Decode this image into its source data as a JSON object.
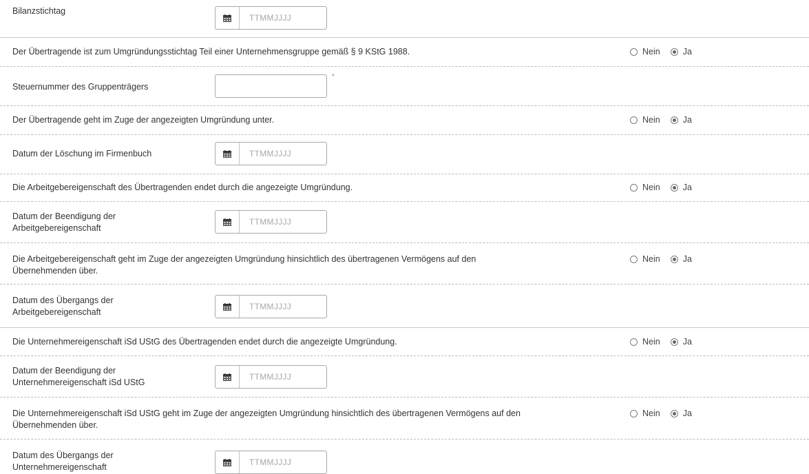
{
  "date_placeholder": "TTMMJJJJ",
  "radio_labels": {
    "no": "Nein",
    "yes": "Ja"
  },
  "required_mark": "*",
  "fields": {
    "bilanzstichtag": {
      "label": "Bilanzstichtag",
      "value": ""
    },
    "q_unternehmensgruppe": {
      "label": "Der Übertragende ist zum Umgründungsstichtag Teil einer Unternehmensgruppe gemäß § 9 KStG 1988.",
      "selected": "Ja"
    },
    "steuernummer_gruppentraeger": {
      "label": "Steuernummer des Gruppenträgers",
      "value": ""
    },
    "q_untergang": {
      "label": "Der Übertragende geht im Zuge der angezeigten Umgründung unter.",
      "selected": "Ja"
    },
    "datum_loeschung": {
      "label": "Datum der Löschung im Firmenbuch",
      "value": ""
    },
    "q_arbeitgeber_endet": {
      "label": "Die Arbeitgebereigenschaft des Übertragenden endet durch die angezeigte Umgründung.",
      "selected": "Ja"
    },
    "datum_beendigung_arbeitgeber": {
      "label_line1": "Datum der Beendigung der",
      "label_line2": "Arbeitgebereigenschaft",
      "value": ""
    },
    "q_arbeitgeber_uebergang": {
      "label_line1": "Die Arbeitgebereigenschaft geht im Zuge der angezeigten Umgründung hinsichtlich des übertragenen Vermögens auf den",
      "label_line2": "Übernehmenden über.",
      "selected": "Ja"
    },
    "datum_uebergang_arbeitgeber": {
      "label_line1": "Datum des Übergangs der",
      "label_line2": "Arbeitgebereigenschaft",
      "value": ""
    },
    "q_unternehmer_endet": {
      "label": "Die Unternehmereigenschaft iSd UStG des Übertragenden endet durch die angezeigte Umgründung.",
      "selected": "Ja"
    },
    "datum_beendigung_unternehmer": {
      "label_line1": "Datum der Beendigung der",
      "label_line2": "Unternehmereigenschaft iSd UStG",
      "value": ""
    },
    "q_unternehmer_uebergang": {
      "label_line1": "Die Unternehmereigenschaft iSd UStG geht im Zuge der angezeigten Umgründung hinsichtlich des übertragenen Vermögens auf den",
      "label_line2": "Übernehmenden über.",
      "selected": "Ja"
    },
    "datum_uebergang_unternehmer": {
      "label_line1": "Datum des Übergangs der",
      "label_line2": "Unternehmereigenschaft",
      "value": ""
    }
  }
}
